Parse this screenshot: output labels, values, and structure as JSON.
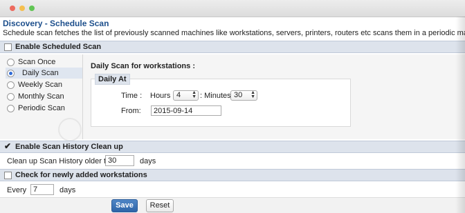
{
  "window": {
    "controls": [
      "close",
      "minimize",
      "zoom"
    ]
  },
  "header": {
    "title": "Discovery - Schedule Scan",
    "description": "Schedule scan fetches the list of previously scanned machines like workstations, servers, printers, routers etc scans them in a periodic manner based on the schedul"
  },
  "enable_scheduled": {
    "label": "Enable Scheduled Scan",
    "checked": false
  },
  "scan_types": [
    {
      "label": "Scan Once",
      "selected": false
    },
    {
      "label": "Daily Scan",
      "selected": true
    },
    {
      "label": "Weekly Scan",
      "selected": false
    },
    {
      "label": "Monthly Scan",
      "selected": false
    },
    {
      "label": "Periodic Scan",
      "selected": false
    }
  ],
  "daily": {
    "heading": "Daily Scan for workstations :",
    "legend": "Daily At",
    "time_label": "Time :",
    "hours_label": "Hours",
    "hours_value": "4",
    "minutes_label": ": Minutes",
    "minutes_value": "30",
    "from_label": "From:",
    "from_value": "2015-09-14"
  },
  "history": {
    "header_label": "Enable Scan History Clean up",
    "checked": true,
    "prefix": "Clean up Scan History older than",
    "value": "30",
    "suffix": "days"
  },
  "new_ws": {
    "header_label": "Check for newly added workstations",
    "checked": false,
    "prefix": "Every",
    "value": "7",
    "suffix": "days"
  },
  "buttons": {
    "save": "Save",
    "reset": "Reset"
  },
  "colors": {
    "title_blue": "#1d4f8c",
    "header_bg": "#dde3ec",
    "save_blue": "#2d64a8"
  }
}
